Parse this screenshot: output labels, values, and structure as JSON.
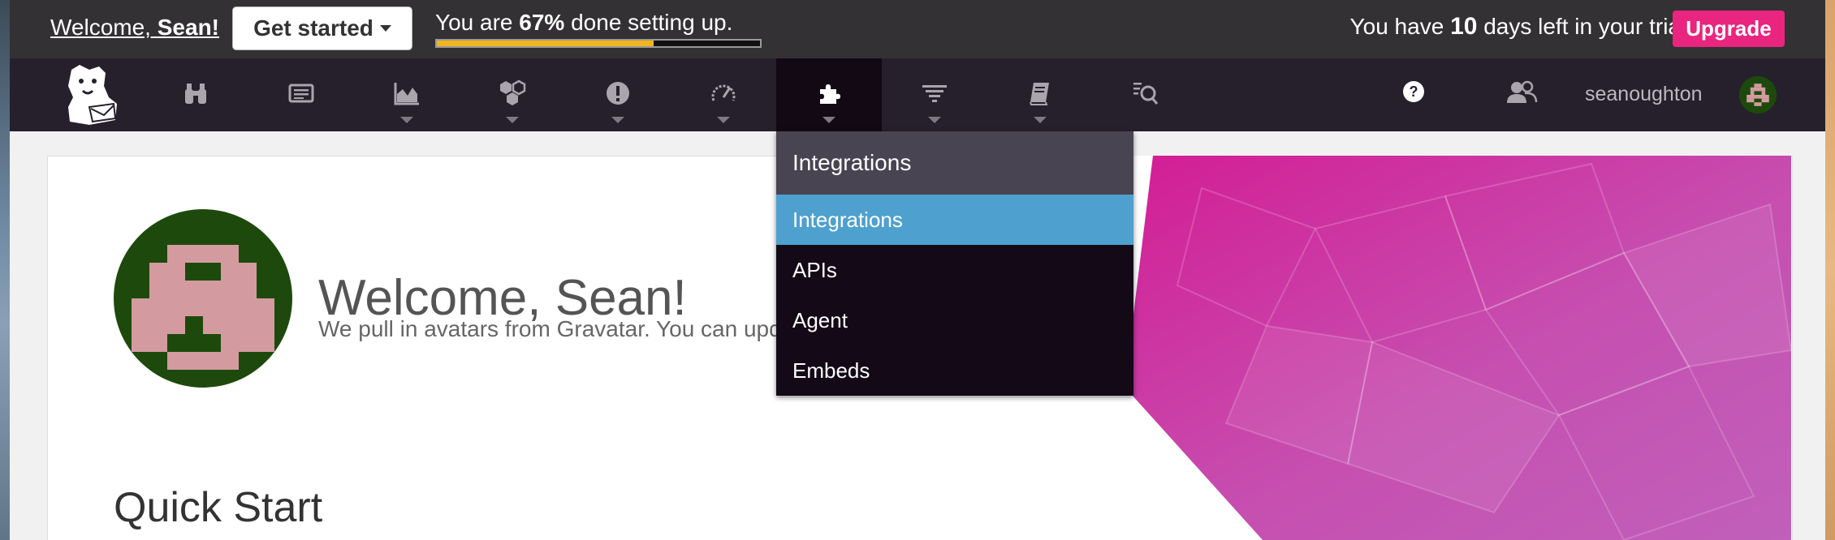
{
  "setup_bar": {
    "welcome_prefix": "Welcome, ",
    "welcome_name": "Sean!",
    "get_started_label": "Get started",
    "progress_prefix": "You are ",
    "progress_percent_text": "67%",
    "progress_suffix": " done setting up.",
    "progress_value": 0.67,
    "progress_color": "#f2b51d",
    "trial_prefix": "You have ",
    "trial_days": "10",
    "trial_suffix": " days left in your trial.",
    "upgrade_label": "Upgrade",
    "upgrade_color": "#e9257f"
  },
  "main_nav": {
    "items": [
      {
        "icon": "binoculars-icon",
        "has_caret": false
      },
      {
        "icon": "dashboard-list-icon",
        "has_caret": false
      },
      {
        "icon": "area-chart-icon",
        "has_caret": true
      },
      {
        "icon": "infrastructure-hexagons-icon",
        "has_caret": true
      },
      {
        "icon": "alert-exclamation-icon",
        "has_caret": true
      },
      {
        "icon": "speedometer-icon",
        "has_caret": true
      },
      {
        "icon": "puzzle-piece-icon",
        "has_caret": true,
        "active": true
      },
      {
        "icon": "filter-lines-icon",
        "has_caret": true
      },
      {
        "icon": "notebook-icon",
        "has_caret": true
      },
      {
        "icon": "synthetics-icon",
        "has_caret": false
      }
    ],
    "help_icon": "question-circle-icon",
    "team_icon": "team-users-icon",
    "username": "seanoughton"
  },
  "integrations_menu": {
    "header": "Integrations",
    "items": [
      "Integrations",
      "APIs",
      "Agent",
      "Embeds"
    ],
    "selected": "Integrations",
    "selected_color": "#4ea1cf"
  },
  "content": {
    "welcome_heading": "Welcome, Sean!",
    "gravatar_text": "We pull in avatars from Gravatar. You can upda",
    "quick_start_heading": "Quick Start"
  }
}
